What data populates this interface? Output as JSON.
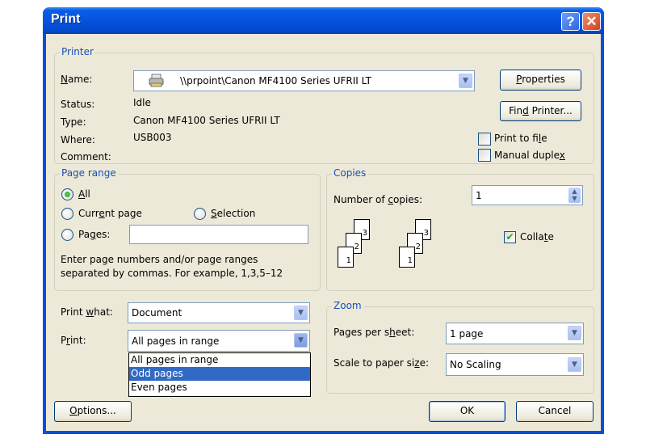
{
  "window": {
    "title": "Print",
    "help_label": "?",
    "close_label": "✕"
  },
  "printer": {
    "group_label": "Printer",
    "name_label": "Name:",
    "name_value": "\\\\prpoint\\Canon MF4100 Series UFRII LT",
    "status_label": "Status:",
    "status_value": "Idle",
    "type_label": "Type:",
    "type_value": "Canon MF4100 Series UFRII LT",
    "where_label": "Where:",
    "where_value": "USB003",
    "comment_label": "Comment:",
    "comment_value": "",
    "properties_button": "Properties",
    "find_printer_button": "Find Printer...",
    "print_to_file_label": "Print to file",
    "print_to_file_checked": false,
    "manual_duplex_label": "Manual duplex",
    "manual_duplex_checked": false
  },
  "page_range": {
    "group_label": "Page range",
    "all_label": "All",
    "current_page_label": "Current page",
    "selection_label": "Selection",
    "pages_label": "Pages:",
    "pages_value": "",
    "selected": "All",
    "hint_line1": "Enter page numbers and/or page ranges",
    "hint_line2": "separated by commas.  For example, 1,3,5–12"
  },
  "copies": {
    "group_label": "Copies",
    "number_label": "Number of copies:",
    "number_value": "1",
    "collate_label": "Collate",
    "collate_checked": true,
    "collate_icon_pages": [
      "1",
      "2",
      "3"
    ]
  },
  "print_what": {
    "label": "Print what:",
    "value": "Document"
  },
  "print": {
    "label": "Print:",
    "value": "All pages in range",
    "options": [
      "All pages in range",
      "Odd pages",
      "Even pages"
    ],
    "highlighted": "Odd pages"
  },
  "zoom": {
    "group_label": "Zoom",
    "pages_per_sheet_label": "Pages per sheet:",
    "pages_per_sheet_value": "1 page",
    "scale_label": "Scale to paper size:",
    "scale_value": "No Scaling"
  },
  "buttons": {
    "options": "Options...",
    "ok": "OK",
    "cancel": "Cancel"
  }
}
